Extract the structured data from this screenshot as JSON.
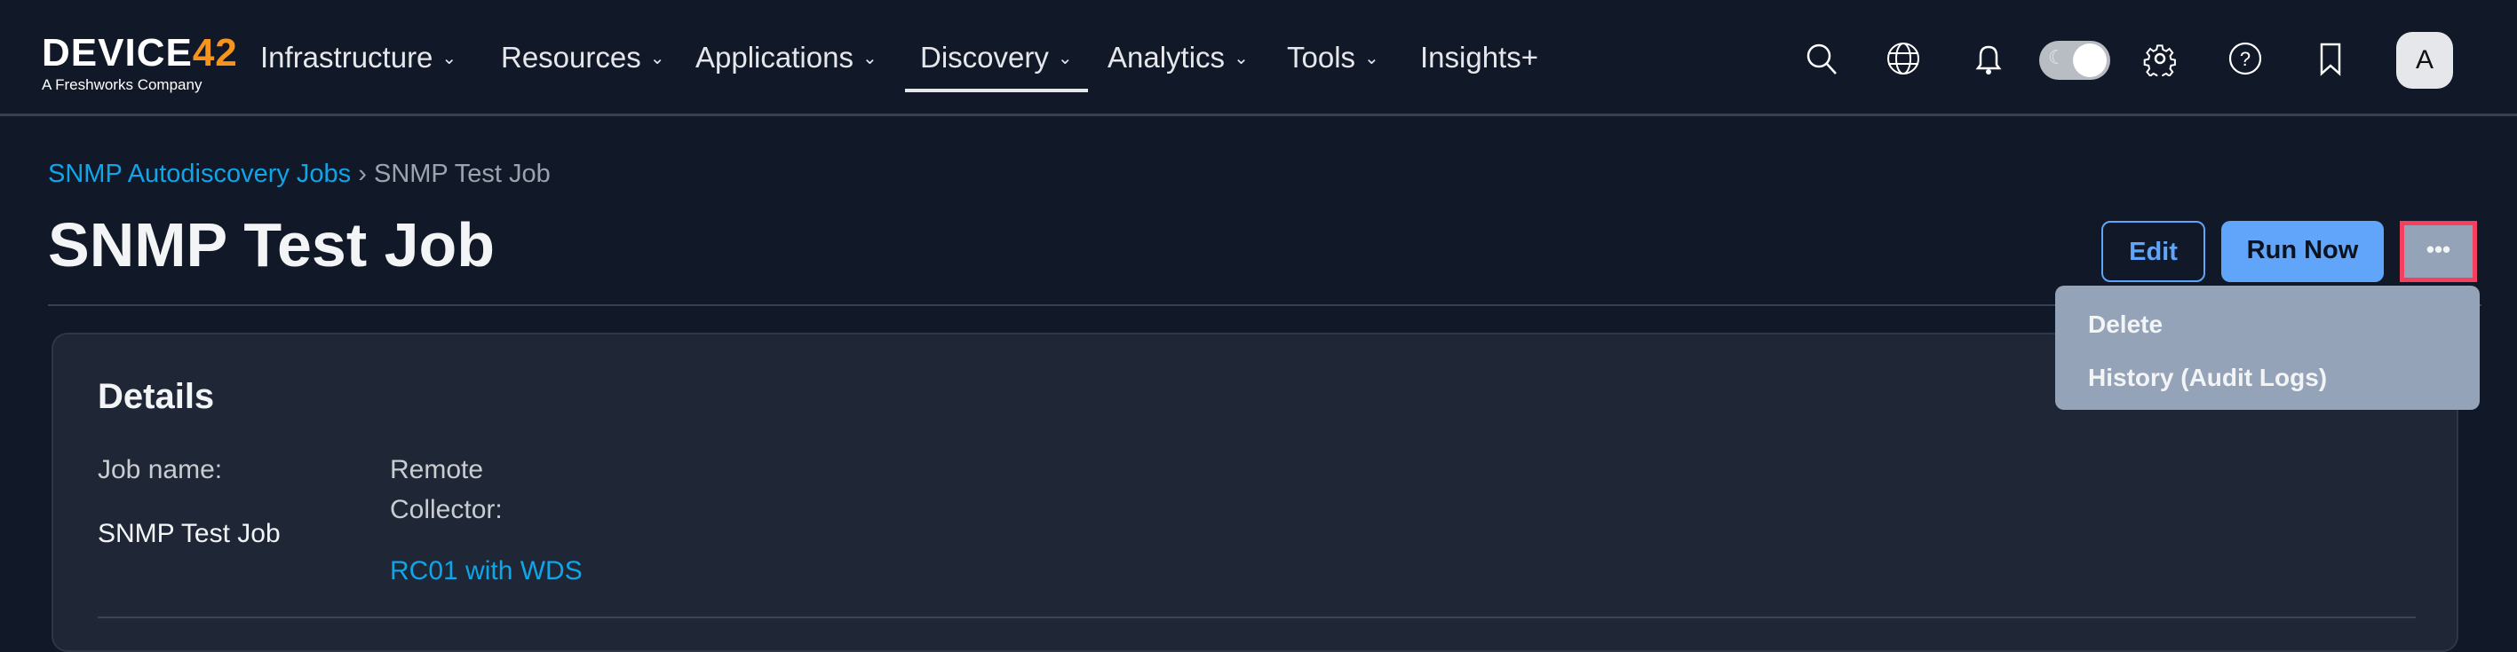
{
  "header": {
    "logo": {
      "main": "DEVICE",
      "accent": "42",
      "sub": "A Freshworks Company"
    },
    "nav": [
      {
        "label": "Infrastructure",
        "has_dropdown": true
      },
      {
        "label": "Resources",
        "has_dropdown": true
      },
      {
        "label": "Applications",
        "has_dropdown": true
      },
      {
        "label": "Discovery",
        "has_dropdown": true,
        "active": true
      },
      {
        "label": "Analytics",
        "has_dropdown": true
      },
      {
        "label": "Tools",
        "has_dropdown": true
      },
      {
        "label": "Insights+",
        "has_dropdown": false
      }
    ],
    "icons": [
      "search-icon",
      "globe-icon",
      "bell-icon",
      "theme-toggle",
      "gear-icon",
      "help-icon",
      "bookmark-icon"
    ],
    "avatar": "A"
  },
  "breadcrumb": {
    "parent": "SNMP Autodiscovery Jobs",
    "separator": "›",
    "current": "SNMP Test Job"
  },
  "page": {
    "title": "SNMP Test Job"
  },
  "actions": {
    "edit": "Edit",
    "run_now": "Run Now",
    "more": "•••"
  },
  "menu": {
    "items": [
      "Delete",
      "History (Audit Logs)"
    ]
  },
  "details": {
    "heading": "Details",
    "job_name_label": "Job name:",
    "job_name": "SNMP Test Job",
    "rc_label_1": "Remote",
    "rc_label_2": "Collector:",
    "rc_value": "RC01 with WDS"
  },
  "colors": {
    "accent": "#60a5fa",
    "link": "#0ea5e9",
    "highlight": "#f43f5e",
    "logo_accent": "#f7941d"
  }
}
